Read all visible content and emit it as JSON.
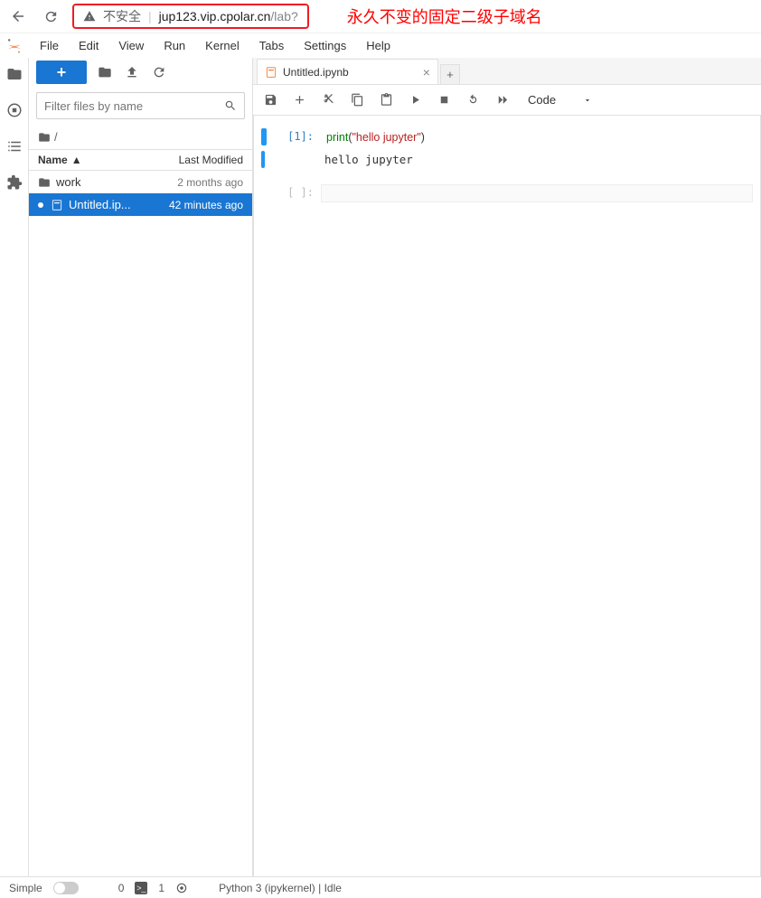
{
  "browser": {
    "security_label": "不安全",
    "domain": "jup123.vip.cpolar.cn",
    "path": "/lab?"
  },
  "annotation": "永久不变的固定二级子域名",
  "menu": {
    "file": "File",
    "edit": "Edit",
    "view": "View",
    "run": "Run",
    "kernel": "Kernel",
    "tabs": "Tabs",
    "settings": "Settings",
    "help": "Help"
  },
  "sidebar": {
    "filter_placeholder": "Filter files by name",
    "breadcrumb_root": "/",
    "col_name": "Name",
    "col_modified": "Last Modified",
    "rows": [
      {
        "name": "work",
        "modified": "2 months ago",
        "type": "folder"
      },
      {
        "name": "Untitled.ip...",
        "modified": "42 minutes ago",
        "type": "notebook"
      }
    ]
  },
  "tab": {
    "title": "Untitled.ipynb"
  },
  "toolbar": {
    "cell_type": "Code"
  },
  "cells": {
    "in_prompt": "[1]:",
    "code_fn": "print",
    "code_paren_open": "(",
    "code_str": "\"hello jupyter\"",
    "code_paren_close": ")",
    "output": "hello jupyter",
    "empty_prompt": "[ ]:"
  },
  "status": {
    "simple": "Simple",
    "count0": "0",
    "count1": "1",
    "kernel": "Python 3 (ipykernel) | Idle"
  }
}
